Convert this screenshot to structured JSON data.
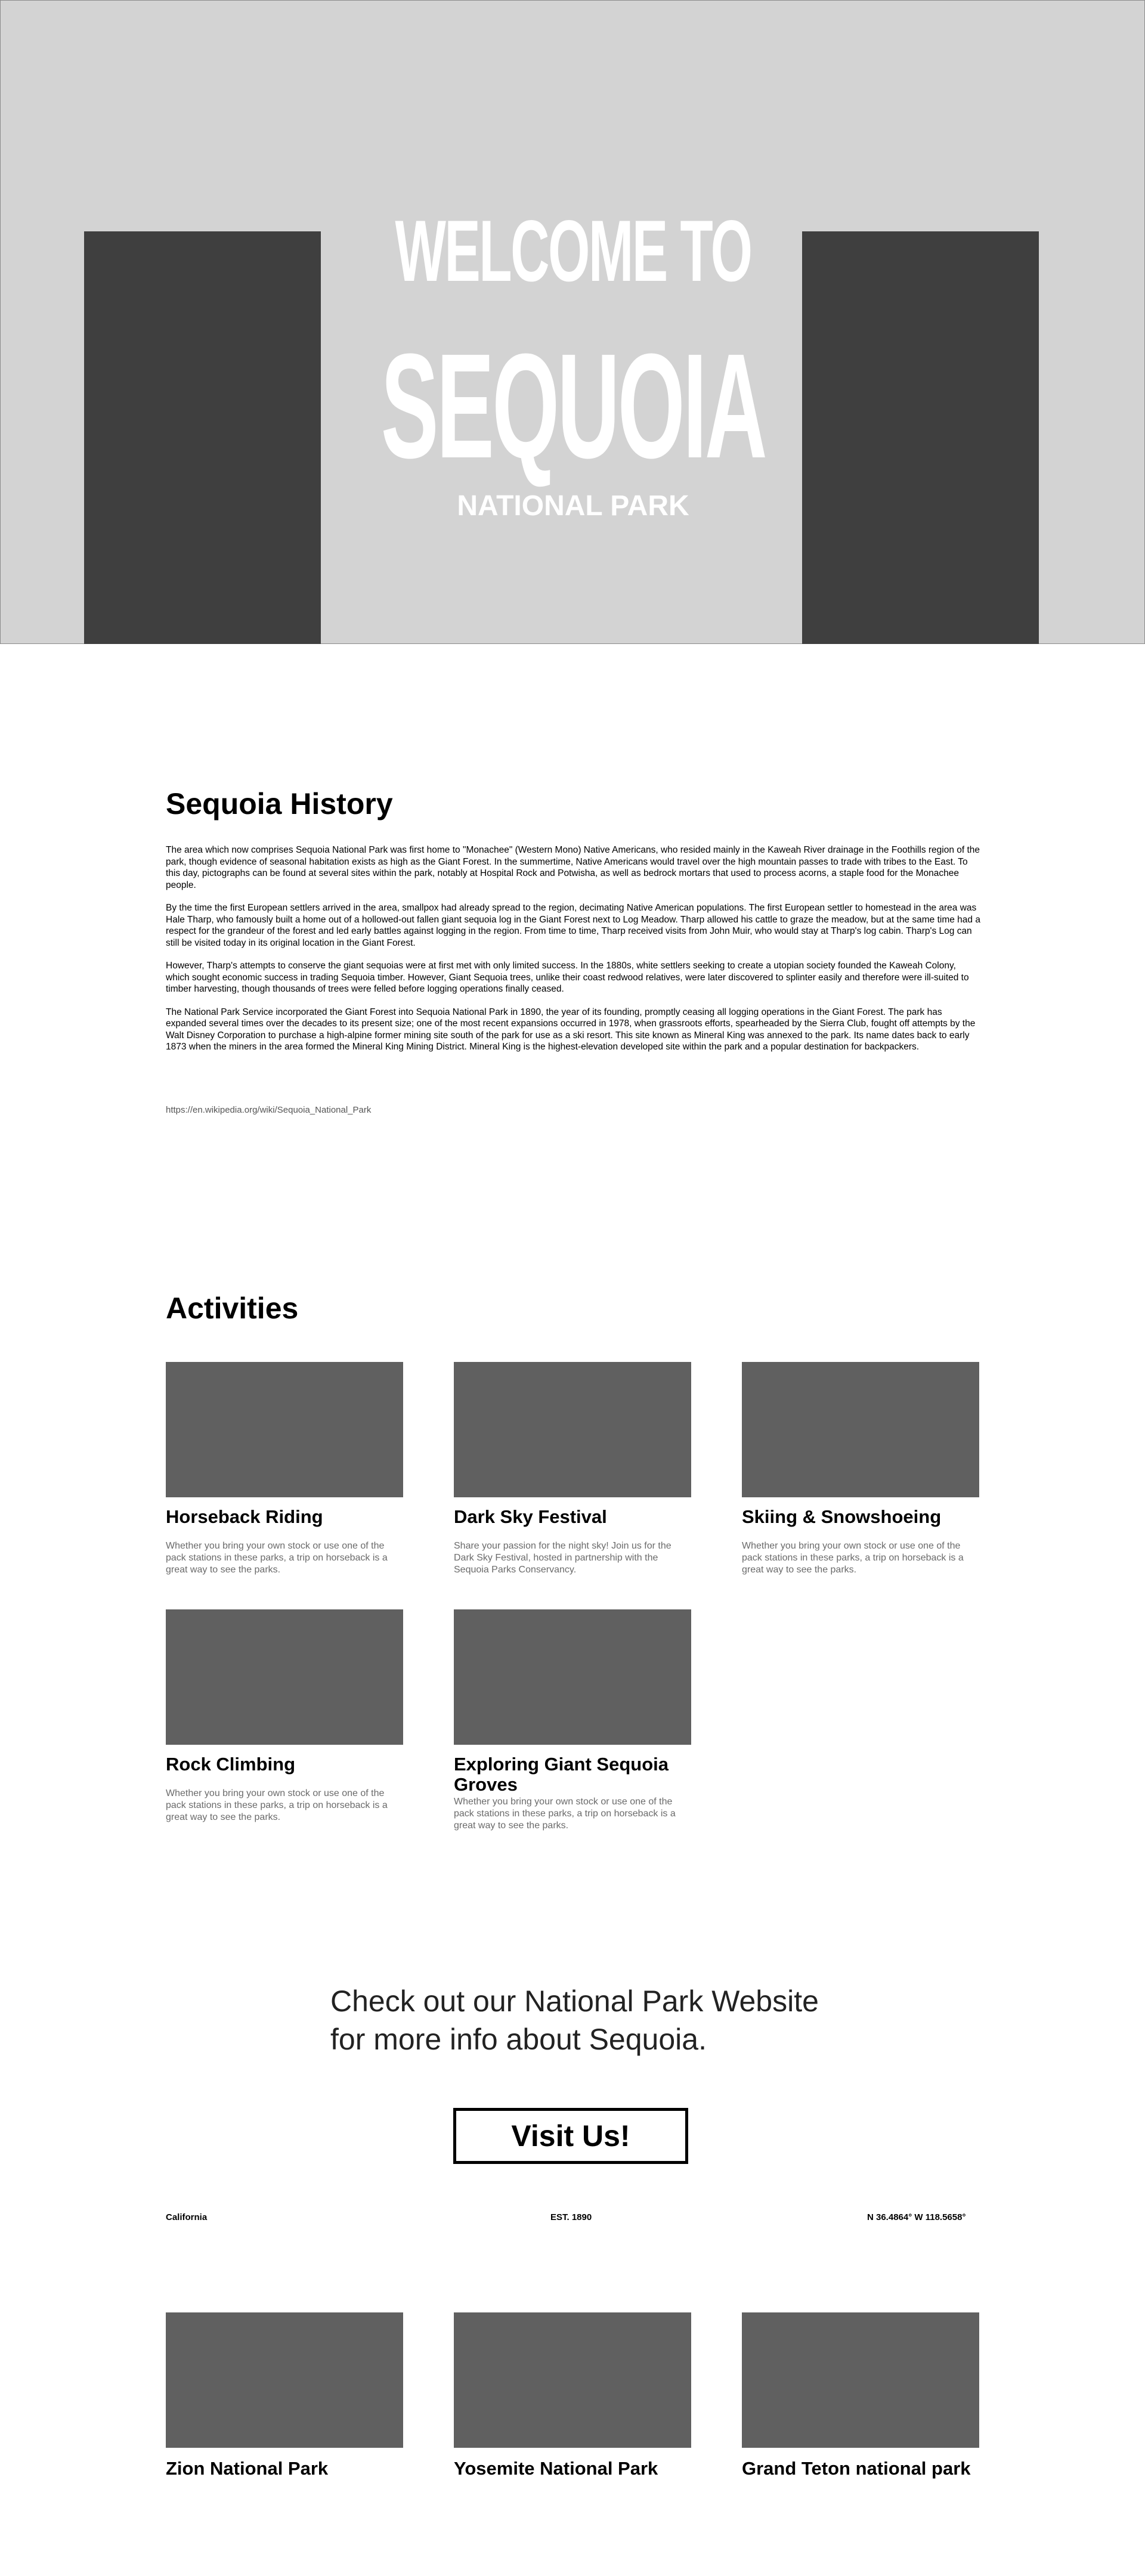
{
  "hero": {
    "welcome": "WELCOME TO",
    "title": "SEQUOIA",
    "subtitle": "NATIONAL PARK"
  },
  "history": {
    "title": "Sequoia History",
    "paragraphs": [
      "The area which now comprises Sequoia National Park was first home to \"Monachee\" (Western Mono) Native Americans, who resided mainly in the Kaweah River drainage in the Foothills region of the park, though evidence of seasonal habitation exists as high as the Giant Forest. In the summertime, Native Americans would travel over the high mountain passes to trade with tribes to the East. To this day, pictographs can be found at several sites within the park, notably at Hospital Rock and Potwisha, as well as bedrock mortars that used to process acorns, a staple food for the Monachee people.",
      "By the time the first European settlers arrived in the area, smallpox had already spread to the region, decimating Native American populations. The first European settler to homestead in the area was Hale Tharp, who famously built a home out of a hollowed-out fallen giant sequoia log in the Giant Forest next to Log Meadow. Tharp allowed his cattle to graze the meadow, but at the same time had a respect for the grandeur of the forest and led early battles against logging in the region. From time to time, Tharp received visits from John Muir, who would stay at Tharp's log cabin. Tharp's Log can still be visited today in its original location in the Giant Forest.",
      "However, Tharp's attempts to conserve the giant sequoias were at first met with only limited success. In the 1880s, white settlers seeking to create a utopian society founded the Kaweah Colony, which sought economic success in trading Sequoia timber. However, Giant Sequoia trees, unlike their coast redwood relatives, were later discovered to splinter easily and therefore were ill-suited to timber harvesting, though thousands of trees were felled before logging operations finally ceased.",
      "The National Park Service incorporated the Giant Forest into Sequoia National Park in 1890, the year of its founding, promptly ceasing all logging operations in the Giant Forest. The park has expanded several times over the decades to its present size; one of the most recent expansions occurred in 1978, when grassroots efforts, spearheaded by the Sierra Club, fought off attempts by the Walt Disney Corporation to purchase a high-alpine former mining site south of the park for use as a ski resort. This site known as Mineral King was annexed to the park. Its name dates back to early 1873 when the miners in the area formed the Mineral King Mining District. Mineral King is the highest-elevation developed site within the park and a popular destination for backpackers."
    ],
    "source": "https://en.wikipedia.org/wiki/Sequoia_National_Park"
  },
  "activities": {
    "title": "Activities",
    "items": [
      {
        "title": "Horseback Riding",
        "desc": "Whether you bring your own stock or use one of the pack stations in these parks, a trip on horseback is a great way to see the parks."
      },
      {
        "title": "Dark Sky Festival",
        "desc": "Share your passion for the night sky! Join us for the Dark Sky Festival, hosted in partnership with the Sequoia Parks Conservancy."
      },
      {
        "title": "Skiing & Snowshoeing",
        "desc": "Whether you bring your own stock or use one of the pack stations in these parks, a trip on horseback is a great way to see the parks."
      },
      {
        "title": "Rock Climbing",
        "desc": "Whether you bring your own stock or use one of the pack stations in these parks, a trip on horseback is a great way to see the parks."
      },
      {
        "title": "Exploring Giant Sequoia Groves",
        "desc": "Whether you bring your own stock or use one of the pack stations in these parks, a trip on horseback is a great way to see the parks."
      }
    ]
  },
  "cta": {
    "text": "Check out our National Park Website for more info about Sequoia.",
    "button": "Visit Us!"
  },
  "info": {
    "state": "California",
    "established": "EST. 1890",
    "coordinates": "N 36.4864° W 118.5658°"
  },
  "parks": [
    {
      "title": "Zion National Park"
    },
    {
      "title": "Yosemite National Park"
    },
    {
      "title": "Grand Teton national park"
    }
  ]
}
